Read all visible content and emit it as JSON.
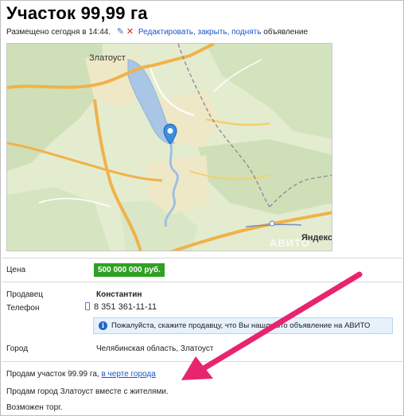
{
  "listing": {
    "title": "Участок 99,99 га",
    "posted": "Размещено сегодня в 14:44.",
    "edit_link": "Редактировать, закрыть, поднять",
    "edit_suffix": "объявление"
  },
  "map": {
    "city_label": "Златоуст",
    "provider_logo": "Яндекс",
    "watermark": "АВИТО"
  },
  "details": {
    "price_label": "Цена",
    "price_value": "500 000 000 руб.",
    "seller_label": "Продавец",
    "seller_value": "Константин",
    "phone_label": "Телефон",
    "phone_value": "8 351 361-11-11",
    "notice_text": "Пожалуйста, скажите продавцу, что Вы нашли это объявление на АВИТО",
    "city_label": "Город",
    "city_value": "Челябинская область, Златоуст"
  },
  "description": {
    "line1_text": "Продам участок 99.99 га,",
    "line1_link": "в черте города",
    "line2": "Продам город Златоуст вместе с жителями.",
    "line3": "Возможен торг."
  },
  "colors": {
    "price_badge": "#2fa024",
    "link": "#1a56c8",
    "annotation_arrow": "#e8246f"
  },
  "icons": [
    "pencil-icon",
    "delete-x-icon",
    "map-marker-icon",
    "phone-icon",
    "info-icon"
  ]
}
